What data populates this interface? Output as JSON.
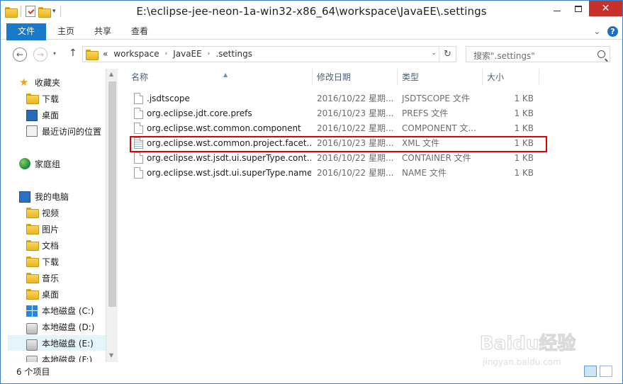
{
  "window": {
    "title": "E:\\eclipse-jee-neon-1a-win32-x86_64\\workspace\\JavaEE\\.settings"
  },
  "ribbon": {
    "tabs": [
      "文件",
      "主页",
      "共享",
      "查看"
    ]
  },
  "address": {
    "prefix": "«",
    "crumbs": [
      "workspace",
      "JavaEE",
      ".settings"
    ]
  },
  "search": {
    "placeholder": "搜索\".settings\""
  },
  "nav": {
    "items": [
      {
        "label": "收藏夹",
        "icon": "star-icon"
      },
      {
        "label": "下载",
        "icon": "folder-icon"
      },
      {
        "label": "桌面",
        "icon": "desktop-icon"
      },
      {
        "label": "最近访问的位置",
        "icon": "recent-icon"
      },
      {
        "label": "家庭组",
        "icon": "homegroup-icon"
      },
      {
        "label": "我的电脑",
        "icon": "computer-icon"
      },
      {
        "label": "视频",
        "icon": "folder-icon"
      },
      {
        "label": "图片",
        "icon": "folder-icon"
      },
      {
        "label": "文档",
        "icon": "folder-icon"
      },
      {
        "label": "下载",
        "icon": "folder-icon"
      },
      {
        "label": "音乐",
        "icon": "folder-icon"
      },
      {
        "label": "桌面",
        "icon": "folder-icon"
      },
      {
        "label": "本地磁盘 (C:)",
        "icon": "windows-drive-icon"
      },
      {
        "label": "本地磁盘 (D:)",
        "icon": "drive-icon"
      },
      {
        "label": "本地磁盘 (E:)",
        "icon": "drive-icon"
      },
      {
        "label": "本地磁盘 (F:)",
        "icon": "drive-icon"
      }
    ]
  },
  "columns": {
    "name": "名称",
    "date": "修改日期",
    "type": "类型",
    "size": "大小"
  },
  "files": [
    {
      "name": ".jsdtscope",
      "date": "2016/10/22 星期...",
      "type": "JSDTSCOPE 文件",
      "size": "1 KB",
      "icon": "file-icon"
    },
    {
      "name": "org.eclipse.jdt.core.prefs",
      "date": "2016/10/23 星期...",
      "type": "PREFS 文件",
      "size": "1 KB",
      "icon": "file-icon"
    },
    {
      "name": "org.eclipse.wst.common.component",
      "date": "2016/10/22 星期...",
      "type": "COMPONENT 文...",
      "size": "1 KB",
      "icon": "file-icon"
    },
    {
      "name": "org.eclipse.wst.common.project.facet...",
      "date": "2016/10/23 星期...",
      "type": "XML 文件",
      "size": "1 KB",
      "icon": "xml-file-icon"
    },
    {
      "name": "org.eclipse.wst.jsdt.ui.superType.cont...",
      "date": "2016/10/22 星期...",
      "type": "CONTAINER 文件",
      "size": "1 KB",
      "icon": "file-icon"
    },
    {
      "name": "org.eclipse.wst.jsdt.ui.superType.name",
      "date": "2016/10/22 星期...",
      "type": "NAME 文件",
      "size": "1 KB",
      "icon": "file-icon"
    }
  ],
  "status": {
    "count": "6 个项目"
  },
  "watermark": {
    "text": "Baidu经验",
    "url": "jingyan.baidu.com"
  },
  "colors": {
    "accent": "#1979ca",
    "highlight": "#e00000",
    "close": "#c7302b"
  }
}
